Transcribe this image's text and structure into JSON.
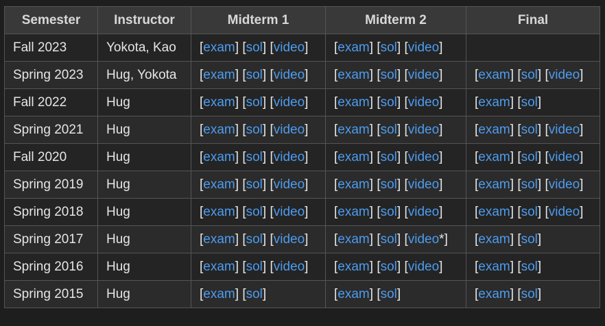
{
  "table": {
    "headers": [
      "Semester",
      "Instructor",
      "Midterm 1",
      "Midterm 2",
      "Final"
    ],
    "rows": [
      {
        "semester": "Fall 2023",
        "instructor": "Yokota, Kao",
        "m1": [
          "exam",
          "sol",
          "video"
        ],
        "m2": [
          "exam",
          "sol",
          "video"
        ],
        "final": []
      },
      {
        "semester": "Spring 2023",
        "instructor": "Hug, Yokota",
        "m1": [
          "exam",
          "sol",
          "video"
        ],
        "m2": [
          "exam",
          "sol",
          "video"
        ],
        "final": [
          "exam",
          "sol",
          "video"
        ]
      },
      {
        "semester": "Fall 2022",
        "instructor": "Hug",
        "m1": [
          "exam",
          "sol",
          "video"
        ],
        "m2": [
          "exam",
          "sol",
          "video"
        ],
        "final": [
          "exam",
          "sol"
        ]
      },
      {
        "semester": "Spring 2021",
        "instructor": "Hug",
        "m1": [
          "exam",
          "sol",
          "video"
        ],
        "m2": [
          "exam",
          "sol",
          "video"
        ],
        "final": [
          "exam",
          "sol",
          "video"
        ]
      },
      {
        "semester": "Fall 2020",
        "instructor": "Hug",
        "m1": [
          "exam",
          "sol",
          "video"
        ],
        "m2": [
          "exam",
          "sol",
          "video"
        ],
        "final": [
          "exam",
          "sol",
          "video"
        ]
      },
      {
        "semester": "Spring 2019",
        "instructor": "Hug",
        "m1": [
          "exam",
          "sol",
          "video"
        ],
        "m2": [
          "exam",
          "sol",
          "video"
        ],
        "final": [
          "exam",
          "sol",
          "video"
        ]
      },
      {
        "semester": "Spring 2018",
        "instructor": "Hug",
        "m1": [
          "exam",
          "sol",
          "video"
        ],
        "m2": [
          "exam",
          "sol",
          "video"
        ],
        "final": [
          "exam",
          "sol",
          "video"
        ]
      },
      {
        "semester": "Spring 2017",
        "instructor": "Hug",
        "m1": [
          "exam",
          "sol",
          "video"
        ],
        "m2": [
          "exam",
          "sol",
          "video*"
        ],
        "final": [
          "exam",
          "sol"
        ]
      },
      {
        "semester": "Spring 2016",
        "instructor": "Hug",
        "m1": [
          "exam",
          "sol",
          "video"
        ],
        "m2": [
          "exam",
          "sol",
          "video"
        ],
        "final": [
          "exam",
          "sol"
        ]
      },
      {
        "semester": "Spring 2015",
        "instructor": "Hug",
        "m1": [
          "exam",
          "sol"
        ],
        "m2": [
          "exam",
          "sol"
        ],
        "final": [
          "exam",
          "sol"
        ]
      }
    ]
  },
  "colors": {
    "background": "#1e1e1e",
    "header_bg": "#393939",
    "row_bg": "#242424",
    "row_alt_bg": "#2b2b2b",
    "border": "#555555",
    "link": "#4c9cf0",
    "text": "#e6e6e6"
  }
}
